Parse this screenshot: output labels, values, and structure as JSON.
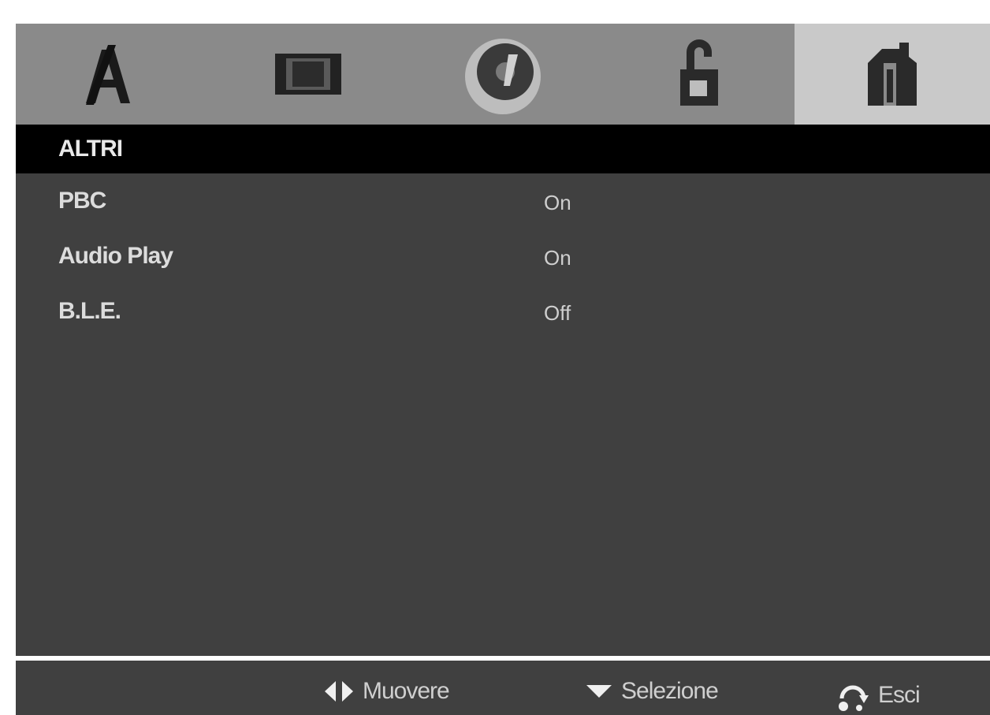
{
  "tabs": [
    {
      "icon": "language-icon",
      "active": false
    },
    {
      "icon": "display-icon",
      "active": false
    },
    {
      "icon": "audio-disc-icon",
      "active": false
    },
    {
      "icon": "lock-icon",
      "active": false
    },
    {
      "icon": "others-icon",
      "active": true
    }
  ],
  "section": {
    "title": "ALTRI"
  },
  "settings": [
    {
      "label": "PBC",
      "value": "On"
    },
    {
      "label": "Audio Play",
      "value": "On"
    },
    {
      "label": "B.L.E.",
      "value": "Off"
    }
  ],
  "footer": {
    "move_label": "Muovere",
    "select_label": "Selezione",
    "exit_label": "Esci"
  },
  "colors": {
    "screen_bg": "#404040",
    "tabbar_bg": "#8a8a8a",
    "active_tab_bg": "#c9c9c9",
    "header_bg": "#000000"
  }
}
